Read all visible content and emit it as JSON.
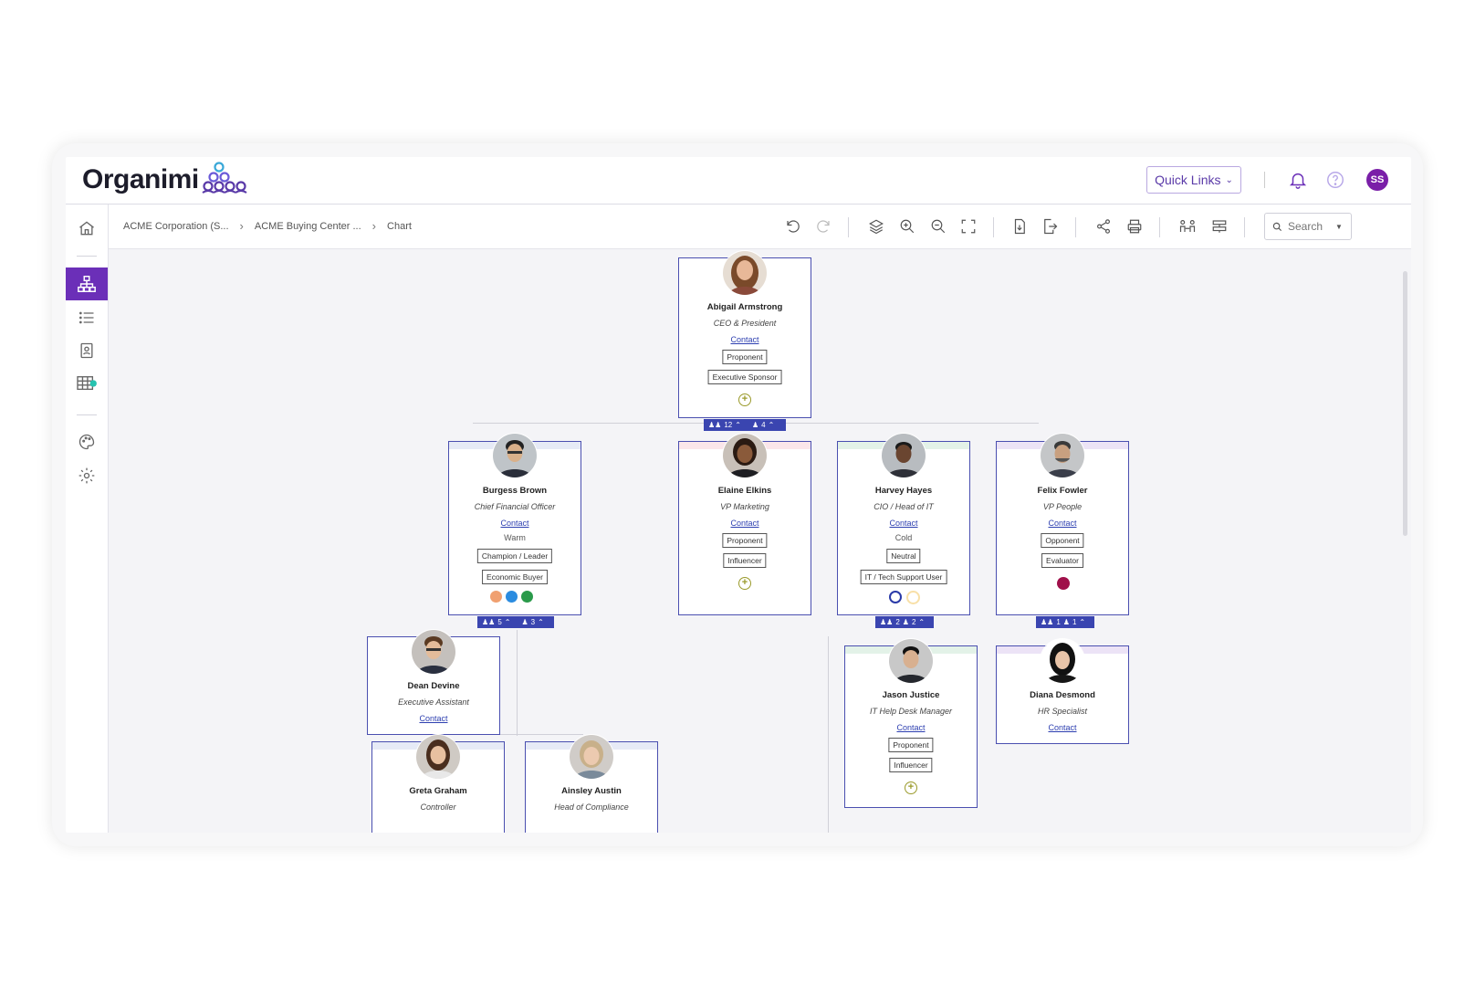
{
  "app": {
    "logo": "Organimi",
    "quick_links": "Quick Links",
    "user_initials": "SS",
    "colors": {
      "accent": "#6b2fb8",
      "badge": "#3a45b0",
      "card_border": "#4a4fb0"
    }
  },
  "breadcrumb": [
    "ACME Corporation (S...",
    "ACME Buying Center ...",
    "Chart"
  ],
  "search": {
    "placeholder": "Search"
  },
  "toolbar_icons": [
    "undo-icon",
    "redo-icon",
    "layers-icon",
    "zoom-in-icon",
    "zoom-out-icon",
    "fit-screen-icon",
    "export-pdf-icon",
    "export-icon",
    "share-icon",
    "print-icon",
    "people-link-icon",
    "layout-icon"
  ],
  "sidebar_icons": [
    "home-icon",
    "org-chart-icon",
    "list-icon",
    "directory-icon",
    "table-icon",
    "palette-icon",
    "settings-icon"
  ],
  "people": {
    "abigail": {
      "name": "Abigail Armstrong",
      "title": "CEO & President",
      "link": "Contact",
      "tags": [
        "Proponent",
        "Executive Sponsor"
      ],
      "badge": {
        "team": "12",
        "direct": "4"
      }
    },
    "burgess": {
      "name": "Burgess Brown",
      "title": "Chief Financial Officer",
      "link": "Contact",
      "temp": "Warm",
      "tags": [
        "Champion / Leader",
        "Economic Buyer"
      ],
      "badge": {
        "team": "5",
        "direct": "3"
      }
    },
    "elaine": {
      "name": "Elaine Elkins",
      "title": "VP Marketing",
      "link": "Contact",
      "tags": [
        "Proponent",
        "Influencer"
      ]
    },
    "harvey": {
      "name": "Harvey Hayes",
      "title": "CIO / Head of IT",
      "link": "Contact",
      "temp": "Cold",
      "tags": [
        "Neutral",
        "IT / Tech Support User"
      ],
      "badge": {
        "team": "2",
        "direct": "2"
      }
    },
    "felix": {
      "name": "Felix Fowler",
      "title": "VP People",
      "link": "Contact",
      "tags": [
        "Opponent",
        "Evaluator"
      ],
      "badge": {
        "team": "1",
        "direct": "1"
      }
    },
    "dean": {
      "name": "Dean Devine",
      "title": "Executive Assistant",
      "link": "Contact"
    },
    "jason": {
      "name": "Jason Justice",
      "title": "IT Help Desk Manager",
      "link": "Contact",
      "tags": [
        "Proponent",
        "Influencer"
      ]
    },
    "diana": {
      "name": "Diana Desmond",
      "title": "HR Specialist",
      "link": "Contact"
    },
    "greta": {
      "name": "Greta Graham",
      "title": "Controller"
    },
    "ainsley": {
      "name": "Ainsley Austin",
      "title": "Head of Compliance"
    }
  }
}
